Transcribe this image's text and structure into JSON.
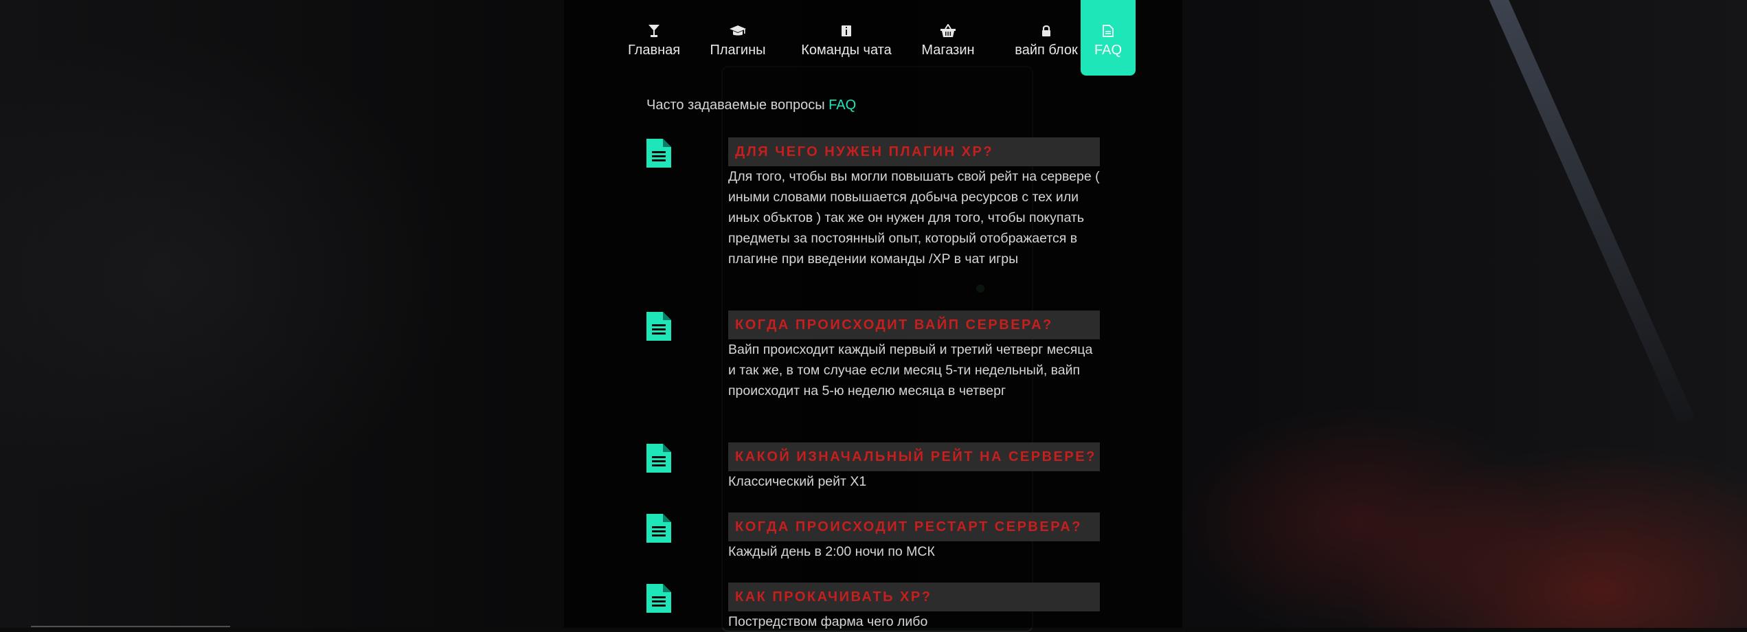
{
  "nav": {
    "items": [
      {
        "label": "Главная",
        "icon": "cocktail-icon"
      },
      {
        "label": "Плагины",
        "icon": "graduation-cap-icon"
      },
      {
        "label": "Команды чата",
        "icon": "info-icon"
      },
      {
        "label": "Магазин",
        "icon": "basket-icon"
      },
      {
        "label": "вайп блок",
        "icon": "lock-icon"
      },
      {
        "label": "FAQ",
        "icon": "document-icon",
        "active": true
      }
    ]
  },
  "intro": {
    "text": "Часто задаваемые вопросы",
    "accent": "FAQ"
  },
  "faq": [
    {
      "question": "Для чего нужен плагин XP?",
      "answer": "Для того, чтобы вы могли повышать свой рейт на сервере ( иными словами повышается добыча ресурсов с тех или иных объктов ) так же он нужен для того, чтобы покупать предметы за постоянный опыт, который отображается в плагине при введении команды /XP в чат игры"
    },
    {
      "question": "Когда происходит вайп сервера?",
      "answer": "Вайп происходит каждый первый и третий четверг месяца и так же, в том случае если месяц 5-ти недельный, вайп происходит на 5-ю неделю месяца в четверг"
    },
    {
      "question": "Какой изначальный рейт на сервере?",
      "answer": "Классический рейт Х1"
    },
    {
      "question": "Когда происходит рестарт сервера?",
      "answer": "Каждый день в 2:00 ночи по МСК"
    },
    {
      "question": "Как прокачивать XP?",
      "answer": "Постредством фарма чего либо"
    }
  ],
  "colors": {
    "accent": "#1ee6b8",
    "question_text": "#c71e1e",
    "question_bg": "#2c2c2d"
  }
}
